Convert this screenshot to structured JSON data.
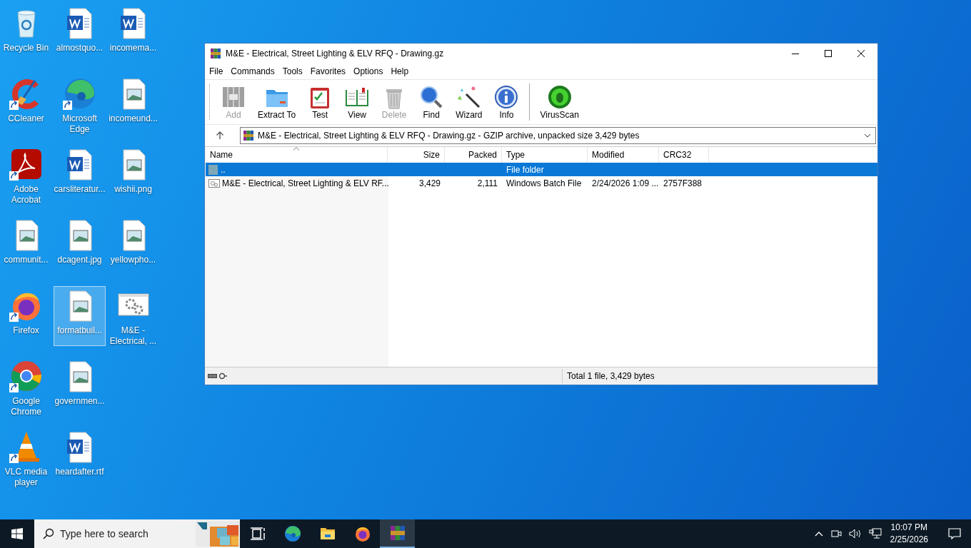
{
  "desktop": {
    "icons": [
      {
        "label": "Recycle Bin",
        "kind": "recycle",
        "shortcut": false,
        "selected": false
      },
      {
        "label": "CCleaner",
        "kind": "ccleaner",
        "shortcut": true,
        "selected": false
      },
      {
        "label": "Adobe Acrobat",
        "kind": "acrobat",
        "shortcut": true,
        "selected": false
      },
      {
        "label": "communit...",
        "shortcut": false,
        "selected": false
      },
      {
        "label": "Firefox",
        "kind": "firefox",
        "shortcut": true,
        "selected": false
      },
      {
        "label": "Google Chrome",
        "kind": "chrome",
        "shortcut": true,
        "selected": false
      },
      {
        "label": "VLC media player",
        "kind": "vlc",
        "shortcut": true,
        "selected": false
      },
      {
        "label": "almostquo...",
        "kind": "word",
        "shortcut": false,
        "selected": false
      },
      {
        "label": "Microsoft Edge",
        "kind": "edge",
        "shortcut": true,
        "selected": false
      },
      {
        "label": "carsliteratur...",
        "kind": "word",
        "shortcut": false,
        "selected": false
      },
      {
        "label": "dcagent.jpg",
        "shortcut": false,
        "selected": false
      },
      {
        "label": "formatbuil...",
        "shortcut": false,
        "selected": true
      },
      {
        "label": "governmen...",
        "shortcut": false,
        "selected": false
      },
      {
        "label": "heardafter.rtf",
        "kind": "word",
        "shortcut": false,
        "selected": false
      },
      {
        "label": "incomema...",
        "kind": "word",
        "shortcut": false,
        "selected": false
      },
      {
        "label": "incomeund...",
        "shortcut": false,
        "selected": false
      },
      {
        "label": "wishii.png",
        "shortcut": false,
        "selected": false
      },
      {
        "label": "yellowpho...",
        "shortcut": false,
        "selected": false
      },
      {
        "label": "M&E - Electrical, ...",
        "kind": "batch",
        "shortcut": false,
        "selected": false
      }
    ]
  },
  "window": {
    "title": "M&E - Electrical, Street Lighting & ELV RFQ - Drawing.gz",
    "menu": [
      "File",
      "Commands",
      "Tools",
      "Favorites",
      "Options",
      "Help"
    ],
    "toolbar": [
      {
        "label": "Add",
        "kind": "add",
        "disabled": true
      },
      {
        "label": "Extract To",
        "kind": "extract",
        "disabled": false
      },
      {
        "label": "Test",
        "kind": "test",
        "disabled": false
      },
      {
        "label": "View",
        "kind": "view",
        "disabled": false
      },
      {
        "label": "Delete",
        "kind": "delete",
        "disabled": true
      },
      {
        "label": "Find",
        "kind": "find",
        "disabled": false
      },
      {
        "label": "Wizard",
        "kind": "wizard",
        "disabled": false
      },
      {
        "label": "Info",
        "kind": "info",
        "disabled": false
      }
    ],
    "scan_toolbar": [
      {
        "label": "VirusScan",
        "kind": "virus",
        "disabled": false
      }
    ],
    "address": "M&E - Electrical, Street Lighting & ELV RFQ - Drawing.gz - GZIP archive, unpacked size 3,429 bytes",
    "columns": [
      {
        "label": "Name",
        "kind": "text",
        "sorted": true
      },
      {
        "label": "Size",
        "kind": "number",
        "sorted": false
      },
      {
        "label": "Packed",
        "kind": "number",
        "sorted": false
      },
      {
        "label": "Type",
        "kind": "text",
        "sorted": false
      },
      {
        "label": "Modified",
        "kind": "text",
        "sorted": false
      },
      {
        "label": "CRC32",
        "kind": "text",
        "sorted": false
      }
    ],
    "rows": [
      {
        "kind": "folder",
        "selected": true,
        "cells": [
          "..",
          "",
          "",
          "File folder",
          "",
          ""
        ]
      },
      {
        "kind": "batch",
        "selected": false,
        "cells": [
          "M&E - Electrical, Street Lighting & ELV RF...",
          "3,429",
          "2,111",
          "Windows Batch File",
          "2/24/2026 1:09 ...",
          "2757F388"
        ]
      }
    ],
    "status": "Total 1 file, 3,429 bytes"
  },
  "taskbar": {
    "search_placeholder": "Type here to search",
    "apps": [
      {
        "kind": "taskview",
        "active": false
      },
      {
        "kind": "edge",
        "active": false
      },
      {
        "kind": "explorer",
        "active": false
      },
      {
        "kind": "firefox",
        "active": false
      },
      {
        "kind": "winrar",
        "active": true
      }
    ],
    "time": "10:07 PM",
    "date": "2/25/2026"
  }
}
